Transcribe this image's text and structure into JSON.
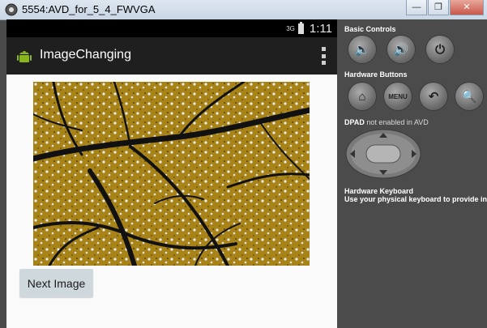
{
  "window": {
    "title": "5554:AVD_for_5_4_FWVGA",
    "minimize": "—",
    "maximize": "❐",
    "close": "✕"
  },
  "status_bar": {
    "signal": "3G",
    "time": "1:11"
  },
  "app": {
    "title": "ImageChanging",
    "overflow_icon": "overflow-menu-icon",
    "image_icon": "tree-branches-photo"
  },
  "main": {
    "next_button_label": "Next Image"
  },
  "controls": {
    "basic_controls_label": "Basic Controls",
    "basic_controls": [
      {
        "name": "volume-down-icon",
        "glyph": "🔈"
      },
      {
        "name": "volume-up-icon",
        "glyph": "🔊"
      },
      {
        "name": "power-icon",
        "glyph": "⏻"
      }
    ],
    "hardware_buttons_label": "Hardware Buttons",
    "hardware_buttons": [
      {
        "name": "home-icon",
        "glyph": "⌂"
      },
      {
        "name": "menu-button",
        "glyph": "MENU"
      },
      {
        "name": "back-icon",
        "glyph": "↶"
      },
      {
        "name": "search-icon",
        "glyph": "🔍"
      }
    ],
    "dpad_label": "DPAD",
    "dpad_note": "not enabled in AVD",
    "keyboard_title": "Hardware Keyboard",
    "keyboard_desc": "Use your physical keyboard to provide input"
  },
  "colors": {
    "panel_bg": "#4b4b4b",
    "action_bar": "#1f1f1f",
    "button_bg": "#cfd8dc"
  }
}
